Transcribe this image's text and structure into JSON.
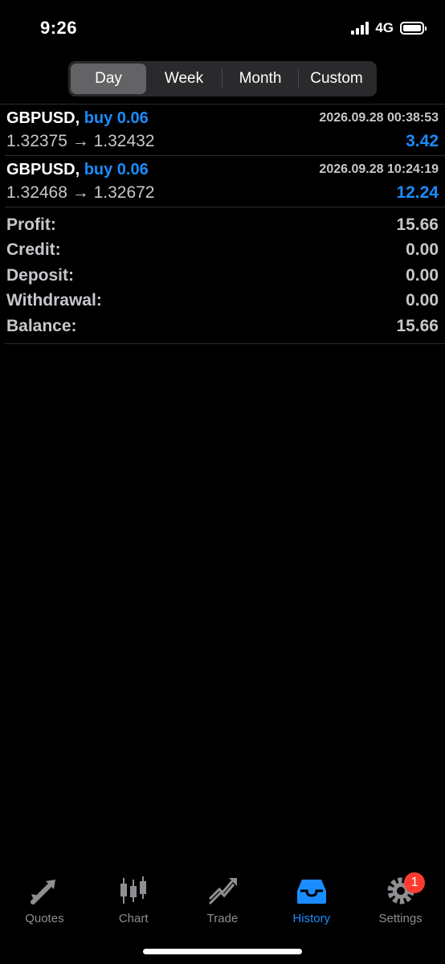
{
  "status": {
    "time": "9:26",
    "network": "4G"
  },
  "periods": [
    "Day",
    "Week",
    "Month",
    "Custom"
  ],
  "active_period": "Day",
  "trades": [
    {
      "symbol": "GBPUSD,",
      "type": "buy 0.06",
      "datetime": "2026.09.28 00:38:53",
      "prices": "1.32375 → 1.32432",
      "profit": "3.42"
    },
    {
      "symbol": "GBPUSD,",
      "type": "buy 0.06",
      "datetime": "2026.09.28 10:24:19",
      "prices": "1.32468 → 1.32672",
      "profit": "12.24"
    }
  ],
  "summary": [
    {
      "label": "Profit:",
      "value": "15.66"
    },
    {
      "label": "Credit:",
      "value": "0.00"
    },
    {
      "label": "Deposit:",
      "value": "0.00"
    },
    {
      "label": "Withdrawal:",
      "value": "0.00"
    },
    {
      "label": "Balance:",
      "value": "15.66"
    }
  ],
  "tabs": [
    {
      "label": "Quotes",
      "icon": "quotes-icon"
    },
    {
      "label": "Chart",
      "icon": "chart-icon"
    },
    {
      "label": "Trade",
      "icon": "trade-icon"
    },
    {
      "label": "History",
      "icon": "history-icon"
    },
    {
      "label": "Settings",
      "icon": "settings-icon",
      "badge": "1"
    }
  ],
  "colors": {
    "accent": "#1a8cff",
    "badge": "#ff3b30"
  }
}
